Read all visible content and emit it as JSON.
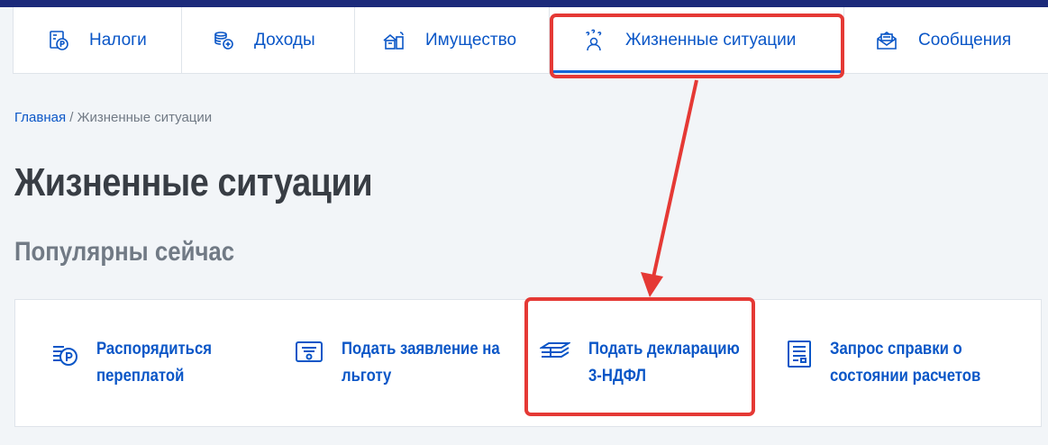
{
  "nav": {
    "items": [
      {
        "label": "Налоги",
        "icon": "ruble-doc-icon"
      },
      {
        "label": "Доходы",
        "icon": "coins-icon"
      },
      {
        "label": "Имущество",
        "icon": "property-icon"
      },
      {
        "label": "Жизненные ситуации",
        "icon": "life-situations-icon",
        "active": true
      },
      {
        "label": "Сообщения",
        "icon": "envelope-icon"
      }
    ]
  },
  "breadcrumb": {
    "home": "Главная",
    "separator": " / ",
    "current": "Жизненные ситуации"
  },
  "page_title": "Жизненные ситуации",
  "section_title": "Популярны сейчас",
  "cards": [
    {
      "line1": "Распорядиться",
      "line2": "переплатой",
      "icon": "ruble-coins-icon"
    },
    {
      "line1": "Подать заявление на",
      "line2": "льготу",
      "icon": "benefit-card-icon"
    },
    {
      "line1": "Подать декларацию",
      "line2": "3-НДФЛ",
      "icon": "declaration-stack-icon"
    },
    {
      "line1": "Запрос справки о",
      "line2": "состоянии расчетов",
      "icon": "statement-doc-icon"
    }
  ],
  "colors": {
    "accent": "#0a56c7",
    "annotation": "#e53935",
    "title": "#383d44",
    "subtitle": "#717a85",
    "topbar": "#1b2a7a"
  }
}
